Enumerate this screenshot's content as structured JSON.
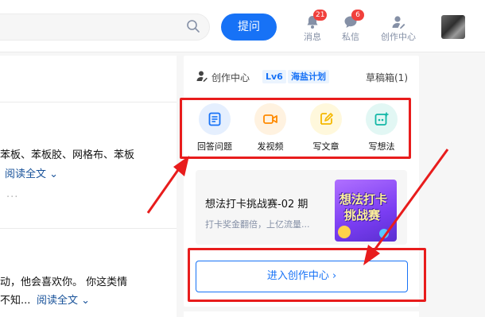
{
  "header": {
    "ask_button": "提问",
    "nav": [
      {
        "label": "消息",
        "badge": "21"
      },
      {
        "label": "私信",
        "badge": "6"
      },
      {
        "label": "创作中心"
      }
    ]
  },
  "feed": {
    "item1_line1": "苯板、苯板胶、网格布、苯板",
    "item1_read_more": "阅读全文",
    "item2_line1": "动，他会喜欢你。 你这类情",
    "item2_line2": "不知...",
    "item2_read_more": "阅读全文",
    "more": "···"
  },
  "creator_panel": {
    "title": "创作中心",
    "level": "Lv6",
    "plan": "海盐计划",
    "drafts": "草稿箱(1)",
    "actions": [
      {
        "label": "回答问题",
        "icon": "document-icon",
        "color": "#1772f6",
        "bg": "#e5effe"
      },
      {
        "label": "发视频",
        "icon": "video-camera-icon",
        "color": "#ff8a00",
        "bg": "#fff2e0"
      },
      {
        "label": "写文章",
        "icon": "pencil-icon",
        "color": "#f5b800",
        "bg": "#fff8dc"
      },
      {
        "label": "写想法",
        "icon": "idea-image-icon",
        "color": "#12b7a6",
        "bg": "#e2f7f4"
      }
    ],
    "promo": {
      "title": "想法打卡挑战赛-02 期",
      "subtitle": "打卡奖金翻倍，上亿流量...",
      "image_line1": "想法打卡",
      "image_line2": "挑战赛"
    },
    "enter_button": "进入创作中心 ›"
  },
  "colors": {
    "accent": "#1772f6",
    "annotation": "#e81c1c",
    "badge": "#f1403c"
  }
}
